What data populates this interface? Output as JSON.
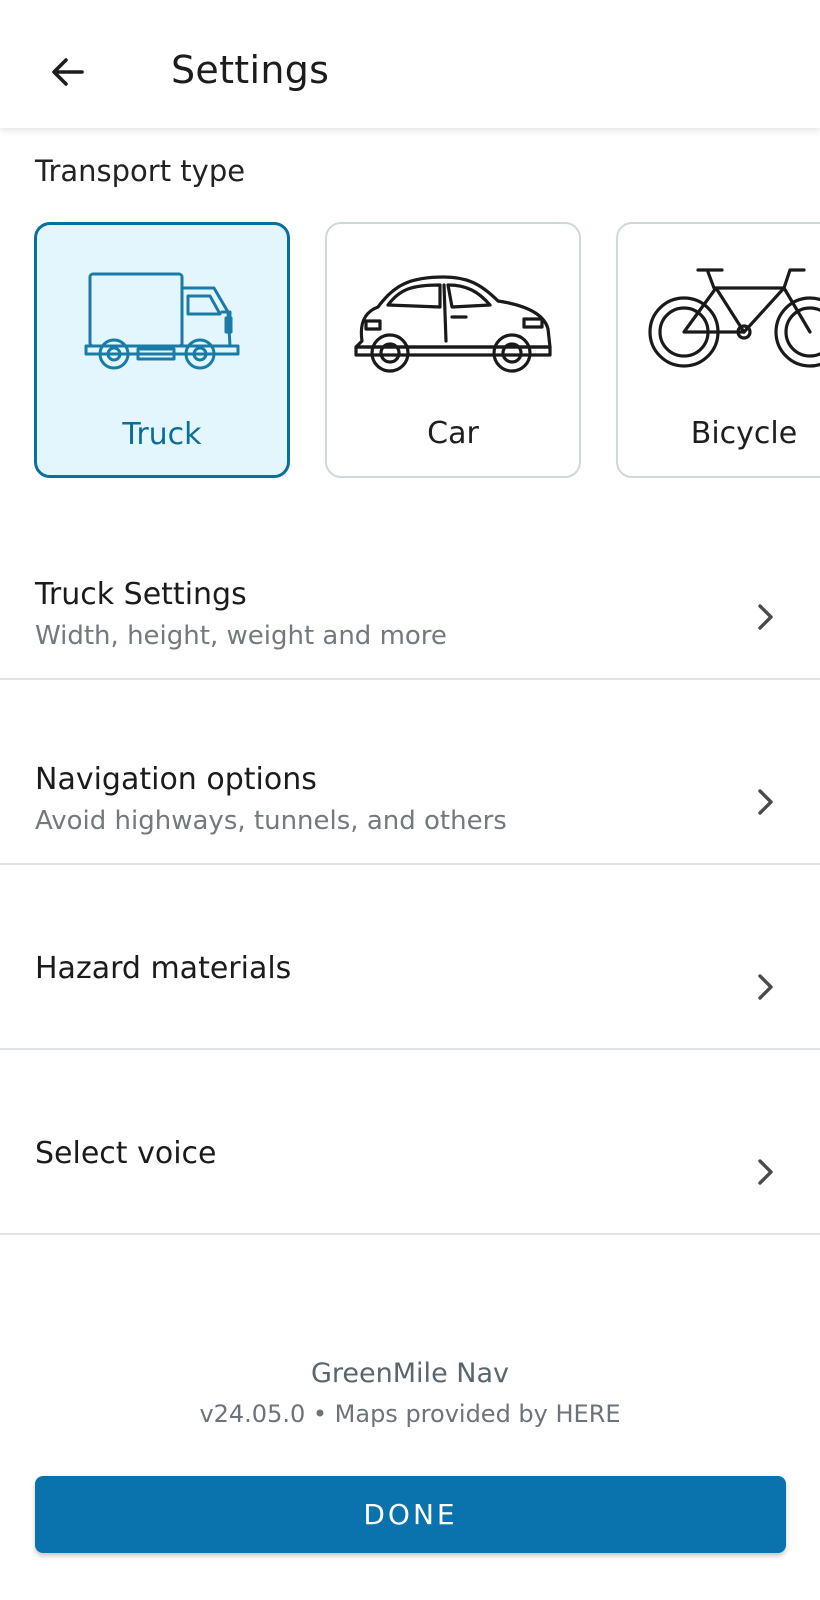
{
  "header": {
    "title": "Settings",
    "back_icon": "arrow-left-icon"
  },
  "transport": {
    "label": "Transport type",
    "options": [
      {
        "label": "Truck",
        "icon": "truck-icon",
        "selected": true
      },
      {
        "label": "Car",
        "icon": "car-icon",
        "selected": false
      },
      {
        "label": "Bicycle",
        "icon": "bicycle-icon",
        "selected": false
      }
    ]
  },
  "settings": {
    "items": [
      {
        "title": "Truck Settings",
        "subtitle": "Width, height, weight and more"
      },
      {
        "title": "Navigation options",
        "subtitle": "Avoid highways, tunnels, and others"
      },
      {
        "title": "Hazard materials",
        "subtitle": ""
      },
      {
        "title": "Select voice",
        "subtitle": ""
      }
    ]
  },
  "footer": {
    "app_name": "GreenMile Nav",
    "version_line": "v24.05.0 • Maps provided by HERE",
    "done_label": "DONE"
  },
  "colors": {
    "accent": "#0a72ac",
    "selected_border": "#0b6f9c",
    "selected_fill": "#e4f6fd"
  }
}
